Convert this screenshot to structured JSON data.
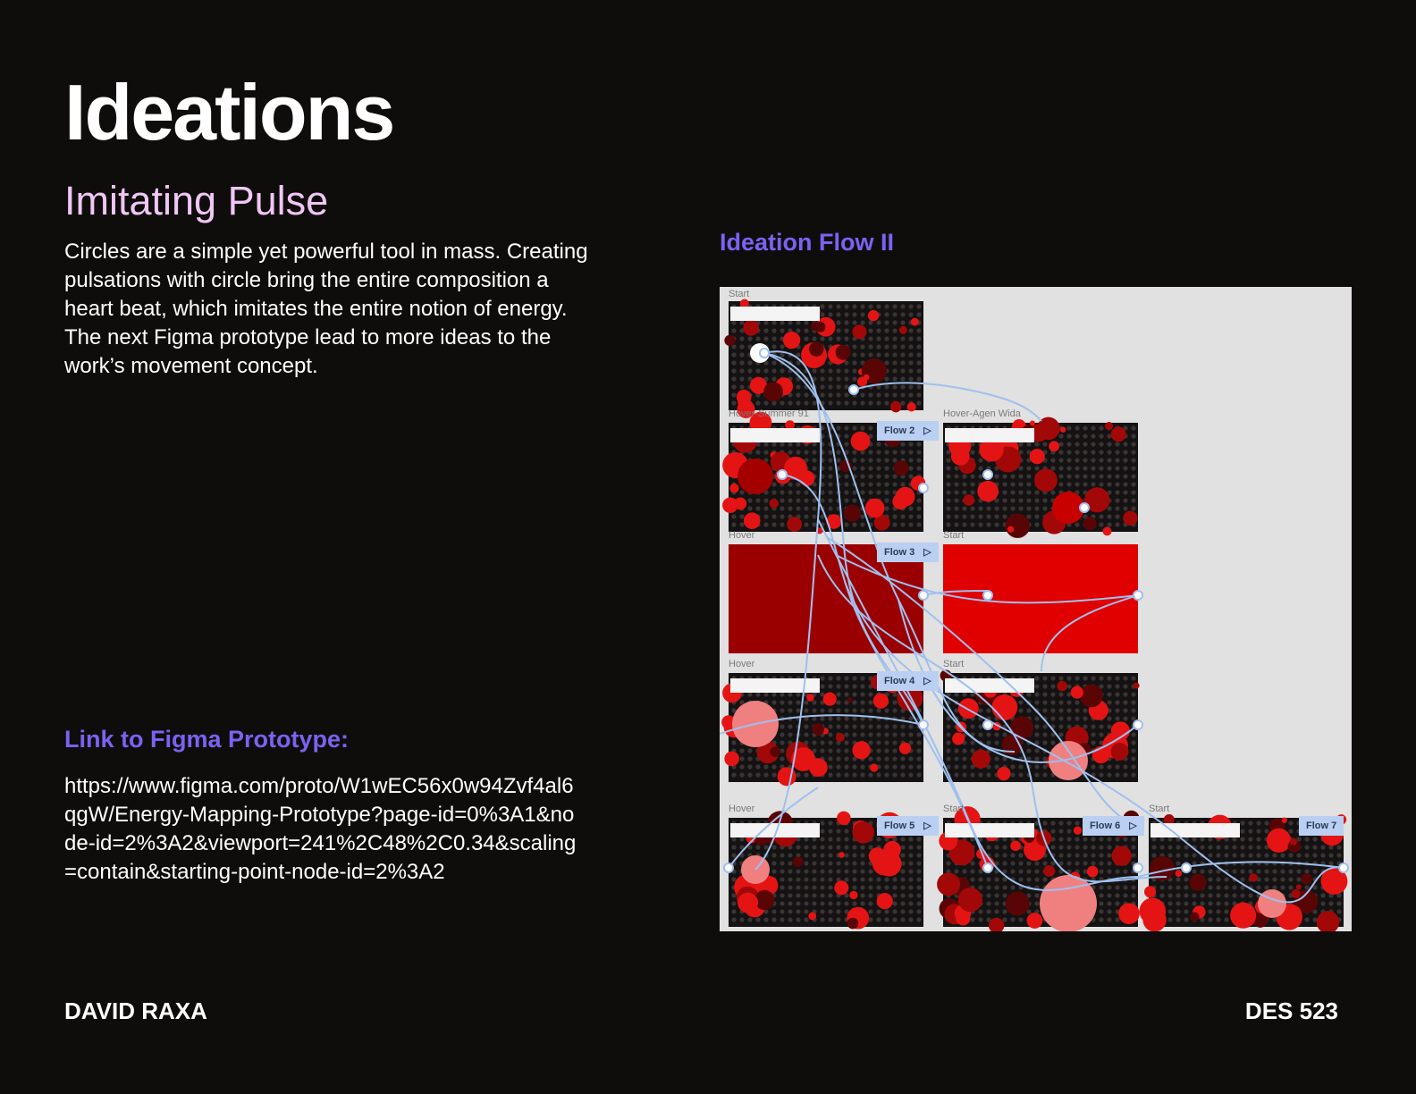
{
  "slide": {
    "title": "Ideations",
    "subtitle": "Imitating Pulse",
    "body": "Circles are a simple yet powerful tool in mass. Creating pulsations with circle bring the entire composition a heart beat, which imitates the entire notion of energy. The next Figma prototype lead to more ideas to the work’s movement concept.",
    "link_label": "Link to Figma Prototype:",
    "link_url": "https://www.figma.com/proto/W1wEC56x0w94Zvf4al6qgW/Energy-Mapping-Prototype?page-id=0%3A1&node-id=2%3A2&viewport=241%2C48%2C0.34&scaling=contain&starting-point-node-id=2%3A2",
    "flow_title": "Ideation Flow II"
  },
  "footer": {
    "author": "DAVID RAXA",
    "course": "DES 523"
  },
  "prototype_canvas": {
    "frame_labels": {
      "r0c0": "Start",
      "r1c0": "Hover-Summer 91",
      "r1c1": "Hover-Agen Wida",
      "r2c0": "Hover",
      "r2c1": "Start",
      "r3c0": "Hover",
      "r3c1": "Start",
      "r4c0": "Hover",
      "r4c1": "Start",
      "r4c2": "Start"
    },
    "flow_tags": {
      "flow2": "Flow 2",
      "flow3": "Flow 3",
      "flow4": "Flow 4",
      "flow5": "Flow 5",
      "flow6": "Flow 6",
      "flow7": "Flow 7"
    },
    "play_icon": "▷",
    "colors": {
      "accent_purple": "#7b62f2",
      "subtitle_pink": "#efc6f5",
      "frame_red": "#e10000",
      "frame_dark_red": "#9b0000",
      "connector_blue": "#9fc0ee",
      "flow_tag_bg": "#b9d0f2"
    }
  }
}
